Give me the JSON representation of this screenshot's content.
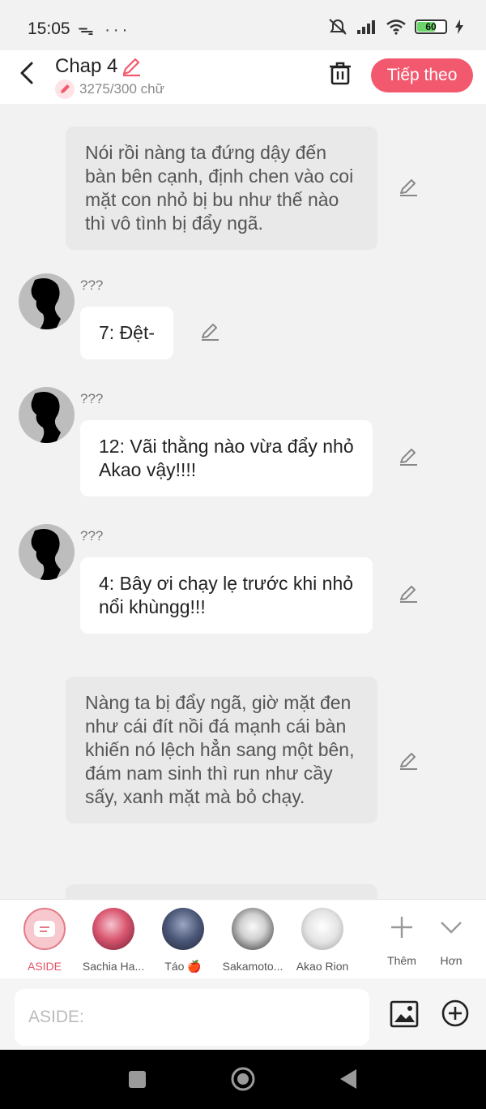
{
  "status": {
    "time": "15:05",
    "left_icons": "ᯓ ···",
    "battery": "60"
  },
  "header": {
    "title": "Chap 4",
    "word_count": "3275/300 chữ",
    "next_label": "Tiếp theo"
  },
  "messages": {
    "n1": "Nói rồi nàng ta đứng dậy đến bàn bên cạnh, định chen vào coi mặt con nhỏ bị bu như thế nào thì vô tình bị đẩy ngã.",
    "m1_speaker": "???",
    "m1": "7: Đệt-",
    "m2_speaker": "???",
    "m2": "12: Vãi thằng nào vừa đẩy nhỏ Akao vậy!!!!",
    "m3_speaker": "???",
    "m3": "4: Bây ơi chạy lẹ trước khi nhỏ nổi khùngg!!!",
    "n2": "Nàng ta bị đẩy ngã, giờ mặt đen như cái đít nồi đá mạnh cái bàn khiến nó lệch hẳn sang một bên, đám nam sinh thì run như cầy sấy, xanh mặt mà bỏ chạy."
  },
  "characters": {
    "aside": "ASIDE",
    "c1": "Sachia Ha...",
    "c2": "Táo 🍎",
    "c3": "Sakamoto...",
    "c4": "Akao Rion",
    "more": "Thêm",
    "collapse": "Hơn"
  },
  "composer": {
    "placeholder": "ASIDE:"
  },
  "colors": {
    "accent": "#f2596e",
    "aside_red": "#e35468",
    "narration_bg": "#e9e9e9"
  }
}
